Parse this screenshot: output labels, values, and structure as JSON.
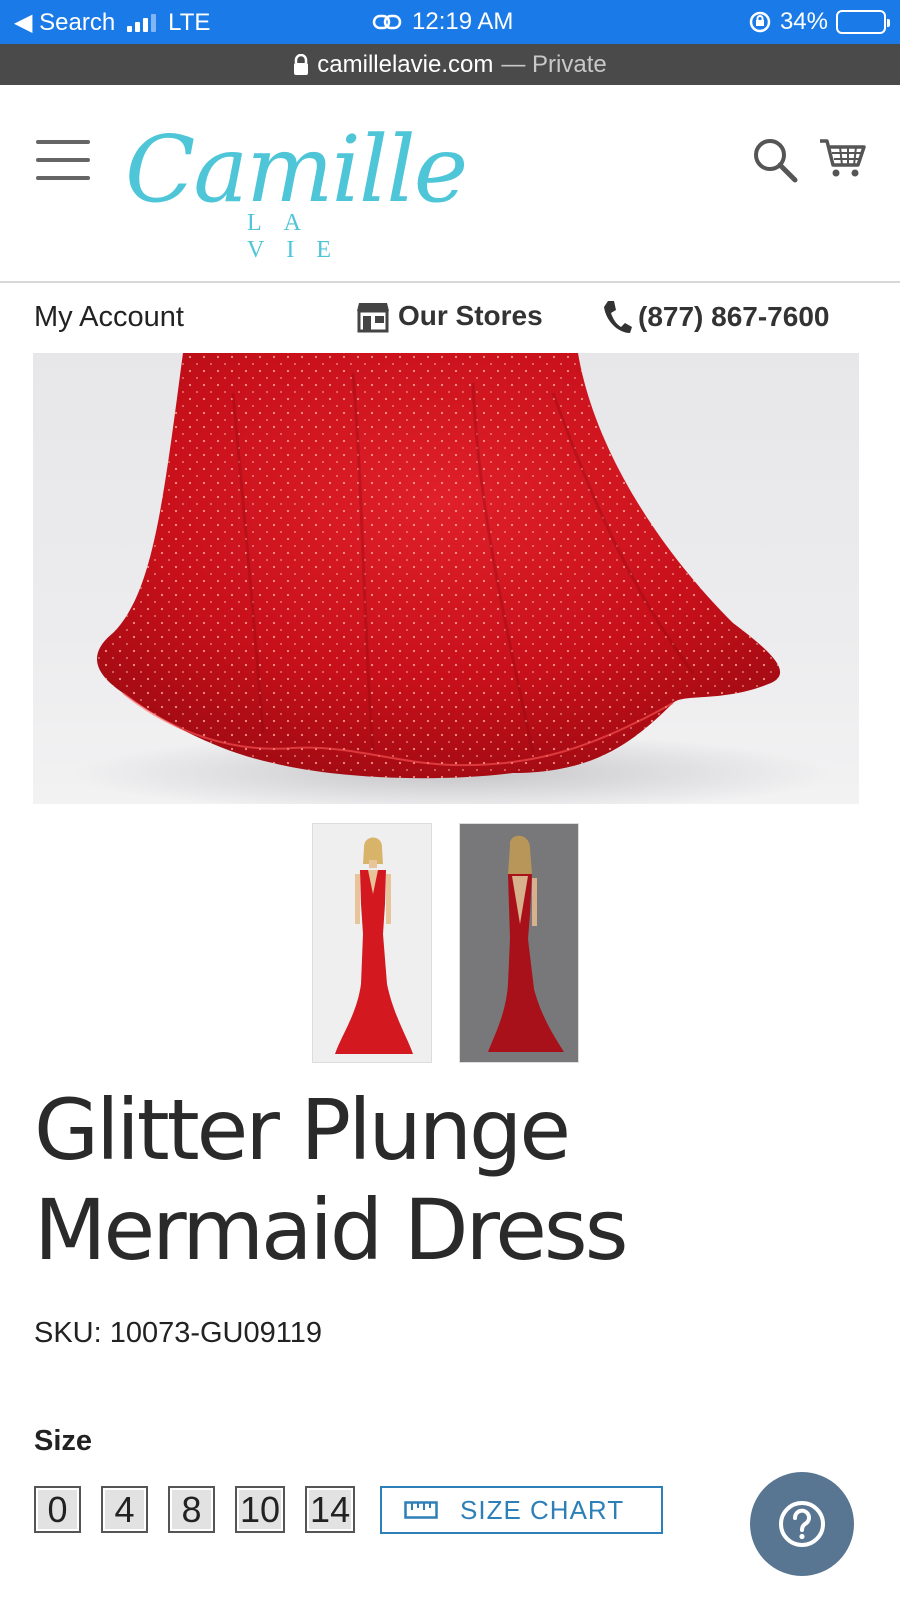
{
  "status_bar": {
    "back_label": "◀ Search",
    "network": "LTE",
    "time": "12:19 AM",
    "battery": "34%",
    "battery_level": 0.34
  },
  "url_bar": {
    "domain": "camillelavie.com",
    "mode": "— Private"
  },
  "header": {
    "logo_script": "Camille",
    "logo_sub": "LA VIE",
    "icons": [
      "menu-icon",
      "search-icon",
      "cart-icon"
    ]
  },
  "util_nav": {
    "account": "My Account",
    "stores": "Our Stores",
    "phone": "(877) 867-7600"
  },
  "product": {
    "title_line1": "Glitter Plunge",
    "title_line2": "Mermaid Dress",
    "sku_label": "SKU:",
    "sku": "10073-GU09119",
    "size_label": "Size",
    "sizes": [
      "0",
      "4",
      "8",
      "10",
      "14"
    ],
    "size_chart": "SIZE CHART"
  },
  "colors": {
    "status_blue": "#1a7ae8",
    "brand_teal": "#4ec6d8",
    "dress_red": "#d0151d",
    "link_blue": "#2d7fb8",
    "help_button": "#587592"
  }
}
